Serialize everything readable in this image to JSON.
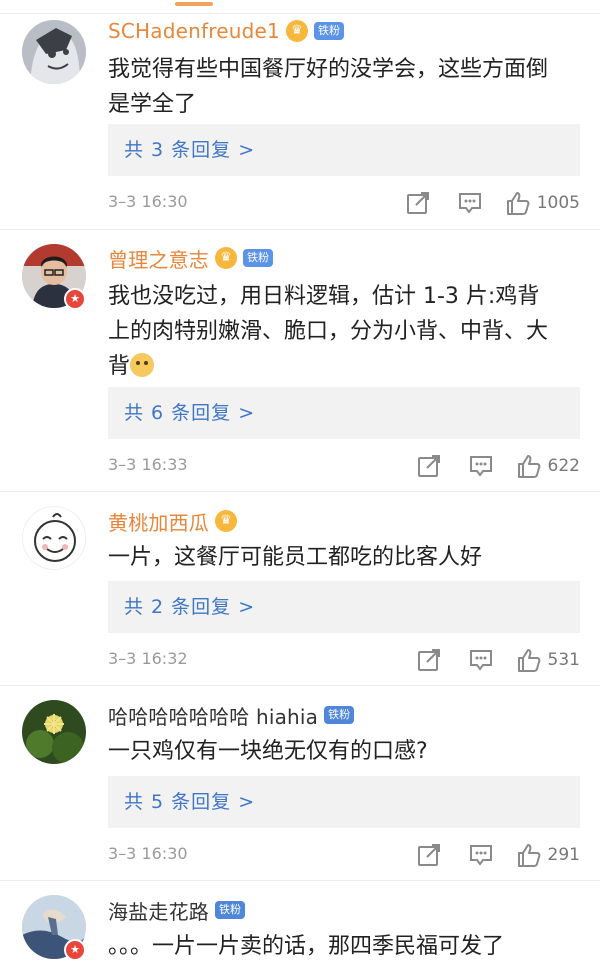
{
  "comments": [
    {
      "username": "SCHadenfreude1",
      "badge": "铁粉",
      "text_lines": [
        "我觉得有些中国餐厅好的没学会，这些方面倒",
        "是学全了"
      ],
      "reply_summary": "共 3 条回复 >",
      "time": "3–3 16:30",
      "likes": "1005"
    },
    {
      "username": "曾理之意志",
      "badge": "铁粉",
      "text_lines": [
        "我也没吃过，用日料逻辑，估计 1-3 片:鸡背",
        "上的肉特别嫩滑、脆口，分为小背、中背、大",
        "背"
      ],
      "reply_summary": "共 6 条回复 >",
      "time": "3–3 16:33",
      "likes": "622"
    },
    {
      "username": "黄桃加西瓜",
      "text_lines": [
        "一片，这餐厅可能员工都吃的比客人好"
      ],
      "reply_summary": "共 2 条回复 >",
      "time": "3–3 16:32",
      "likes": "531"
    },
    {
      "username": "哈哈哈哈哈哈哈 hiahia",
      "badge": "铁粉",
      "text_lines": [
        "一只鸡仅有一块绝无仅有的口感?"
      ],
      "reply_summary": "共 5 条回复 >",
      "time": "3–3 16:30",
      "likes": "291"
    },
    {
      "username": "海盐走花路",
      "badge": "铁粉",
      "text_lines": [
        "。。。一片一片卖的话，那四季民福可发了"
      ]
    }
  ],
  "colors": {
    "username_accent": "#e8873b",
    "reply_link": "#3f76c6",
    "fan_badge": "#5b93e6",
    "crown": "#f6b73c"
  },
  "icons": {
    "share": "share-icon",
    "reply": "comment-icon",
    "like": "thumbs-up-icon",
    "crown": "crown-icon",
    "vip": "vip-star-icon"
  }
}
